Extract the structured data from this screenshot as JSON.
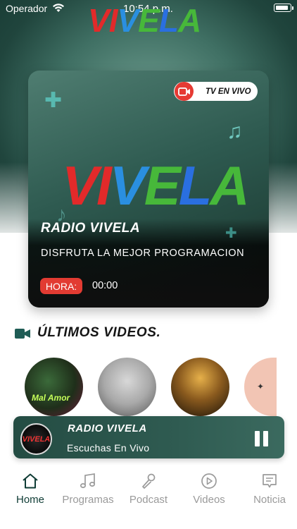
{
  "status_bar": {
    "carrier": "Operador",
    "time": "10:54 p.m."
  },
  "brand": {
    "logo_letters": [
      "V",
      "I",
      "V",
      "E",
      "L",
      "A"
    ],
    "colors": {
      "red": "#e22a2a",
      "blue": "#2a8fe0",
      "green": "#47b83a",
      "accent": "#e23b32",
      "dark_green": "#0f3c35"
    }
  },
  "hero": {
    "tv_live_label": "TV EN VIVO",
    "title": "RADIO VIVELA",
    "subtitle": "DISFRUTA LA MEJOR PROGRAMACION",
    "hora_label": "HORA:",
    "hora_value": "00:00"
  },
  "latest_videos": {
    "title": "ÚLTIMOS VIDEOS.",
    "items": [
      {
        "caption": "Mal Amor"
      },
      {
        "caption": ""
      },
      {
        "caption": ""
      },
      {
        "caption": ""
      }
    ]
  },
  "player": {
    "art_label": "VIVELA",
    "title": "RADIO VIVELA",
    "subtitle": "Escuchas En Vivo"
  },
  "tabs": [
    {
      "label": "Home",
      "icon": "home-icon",
      "active": true
    },
    {
      "label": "Programas",
      "icon": "music-note-icon",
      "active": false
    },
    {
      "label": "Podcast",
      "icon": "microphone-icon",
      "active": false
    },
    {
      "label": "Videos",
      "icon": "play-circle-icon",
      "active": false
    },
    {
      "label": "Noticia",
      "icon": "news-icon",
      "active": false
    }
  ]
}
